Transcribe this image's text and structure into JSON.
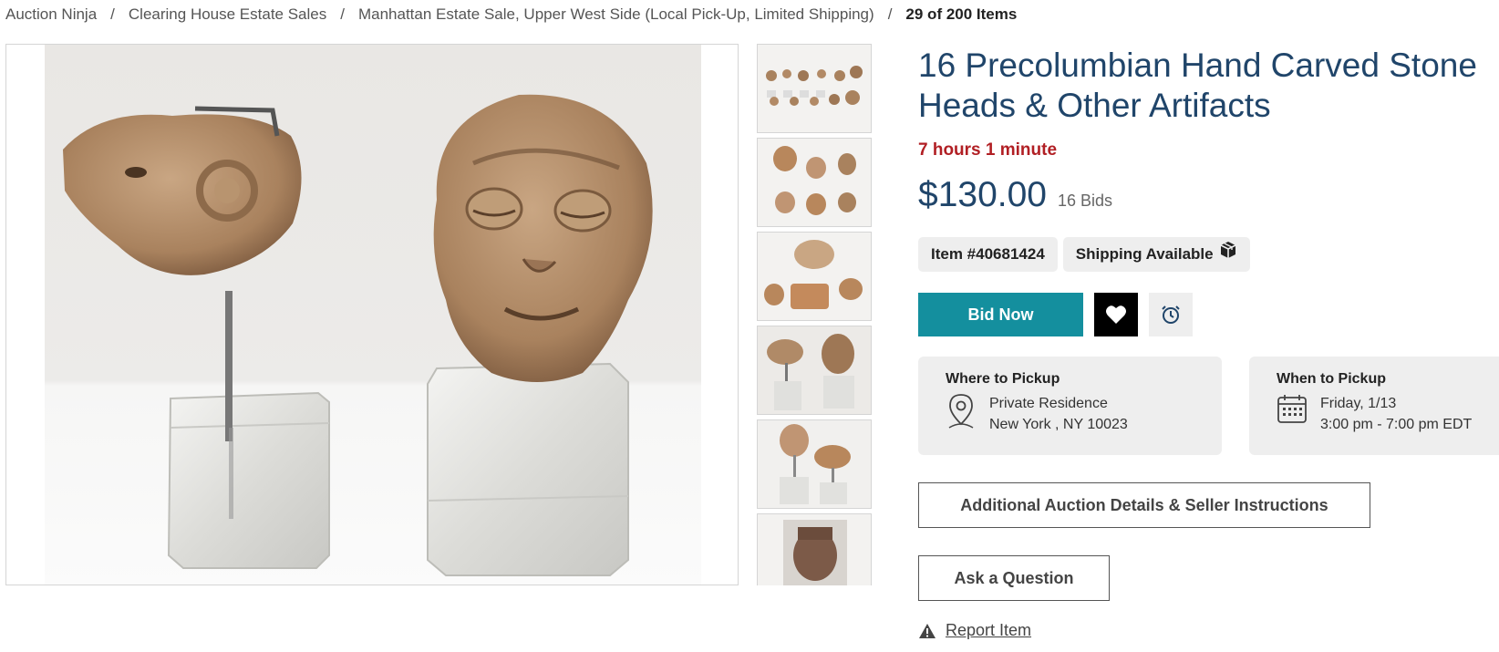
{
  "breadcrumb": {
    "items": [
      "Auction Ninja",
      "Clearing House Estate Sales",
      "Manhattan Estate Sale, Upper West Side (Local Pick-Up, Limited Shipping)"
    ],
    "separator": "/",
    "current": "29 of 200 Items"
  },
  "item": {
    "title": "16 Precolumbian Hand Carved Stone Heads & Other Artifacts",
    "time_left": "7 hours 1 minute",
    "price": "$130.00",
    "bids": "16 Bids",
    "item_number": "Item #40681424",
    "shipping": "Shipping Available"
  },
  "actions": {
    "bid_label": "Bid Now",
    "details_label": "Additional Auction Details & Seller Instructions",
    "question_label": "Ask a Question",
    "report_label": "Report Item"
  },
  "pickup": {
    "where_title": "Where to Pickup",
    "where_line1": "Private Residence",
    "where_line2": "New York , NY 10023",
    "when_title": "When to Pickup",
    "when_line1": "Friday, 1/13",
    "when_line2": "3:00 pm - 7:00 pm EDT"
  },
  "colors": {
    "title": "#20456a",
    "time_left": "#b11f24",
    "bid_button": "#148f9e",
    "card_bg": "#eeeeee"
  },
  "icons": [
    "package-icon",
    "heart-icon",
    "alarm-clock-icon",
    "location-pin-icon",
    "calendar-icon",
    "warning-icon"
  ]
}
